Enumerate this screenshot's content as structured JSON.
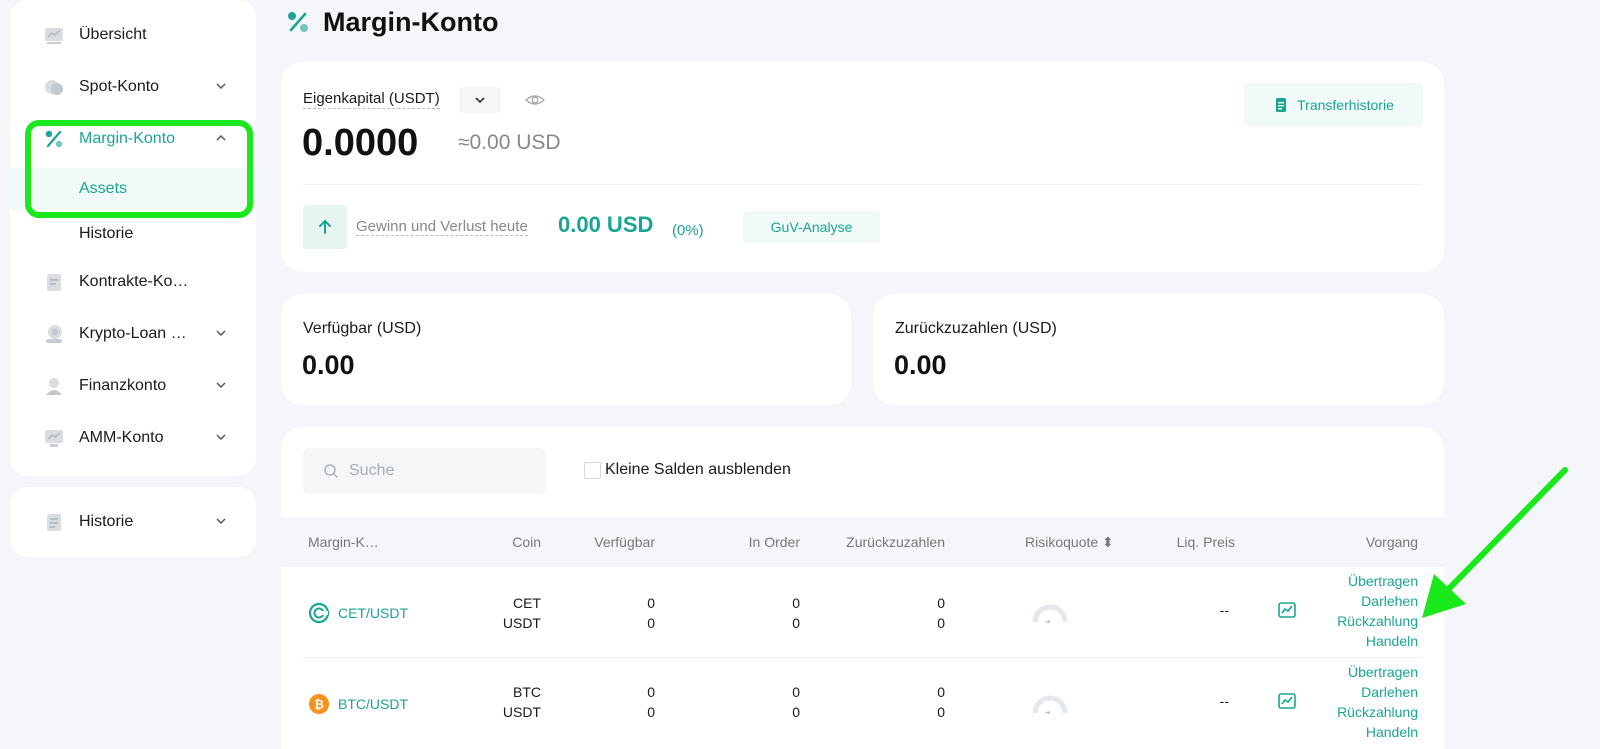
{
  "sidebar": {
    "items": [
      {
        "label": "Übersicht",
        "icon": "chart-icon",
        "has_chevron": false
      },
      {
        "label": "Spot-Konto",
        "icon": "coin-stack-icon",
        "has_chevron": true
      },
      {
        "label": "Margin-Konto",
        "icon": "percent-icon",
        "has_chevron": true,
        "expanded": true
      },
      {
        "label": "Kontrakte-Kon…",
        "icon": "document-icon",
        "has_chevron": false
      },
      {
        "label": "Krypto-Loan K…",
        "icon": "loan-icon",
        "has_chevron": true
      },
      {
        "label": "Finanzkonto",
        "icon": "finance-icon",
        "has_chevron": true
      },
      {
        "label": "AMM-Konto",
        "icon": "monitor-icon",
        "has_chevron": true
      }
    ],
    "margin_sub": [
      {
        "label": "Assets",
        "selected": true
      },
      {
        "label": "Historie",
        "selected": false
      }
    ],
    "history": {
      "label": "Historie",
      "icon": "history-icon"
    }
  },
  "page": {
    "title": "Margin-Konto"
  },
  "equity": {
    "label": "Eigenkapital (USDT)",
    "value": "0.0000",
    "usd": "≈0.00 USD",
    "transfer_label": "Transferhistorie",
    "pnl_label": "Gewinn und Verlust heute",
    "pnl_value": "0.00 USD",
    "pnl_percent": "(0%)",
    "guv_label": "GuV-Analyse"
  },
  "available": {
    "label": "Verfügbar (USD)",
    "value": "0.00"
  },
  "repay": {
    "label": "Zurückzuzahlen (USD)",
    "value": "0.00"
  },
  "filters": {
    "search_placeholder": "Suche",
    "hide_small_label": "Kleine Salden ausblenden"
  },
  "table": {
    "headers": {
      "margin": "Margin-K…",
      "coin": "Coin",
      "available": "Verfügbar",
      "in_order": "In Order",
      "repay": "Zurückzuzahlen",
      "risk": "Risikoquote ⬍",
      "liq": "Liq. Preis",
      "action": "Vorgang"
    },
    "rows": [
      {
        "pair": "CET/USDT",
        "icon": "cet-icon",
        "icon_color": "#1aa592",
        "coin1": "CET",
        "coin2": "USDT",
        "avail1": "0",
        "avail2": "0",
        "order1": "0",
        "order2": "0",
        "repay1": "0",
        "repay2": "0",
        "liq": "--",
        "actions": [
          "Übertragen",
          "Darlehen",
          "Rückzahlung",
          "Handeln"
        ]
      },
      {
        "pair": "BTC/USDT",
        "icon": "btc-icon",
        "icon_color": "#f7931a",
        "coin1": "BTC",
        "coin2": "USDT",
        "avail1": "0",
        "avail2": "0",
        "order1": "0",
        "order2": "0",
        "repay1": "0",
        "repay2": "0",
        "liq": "--",
        "actions": [
          "Übertragen",
          "Darlehen",
          "Rückzahlung",
          "Handeln"
        ]
      }
    ]
  },
  "colors": {
    "accent": "#1aa592",
    "highlight": "#19e81a",
    "background": "#f4f6f9"
  }
}
